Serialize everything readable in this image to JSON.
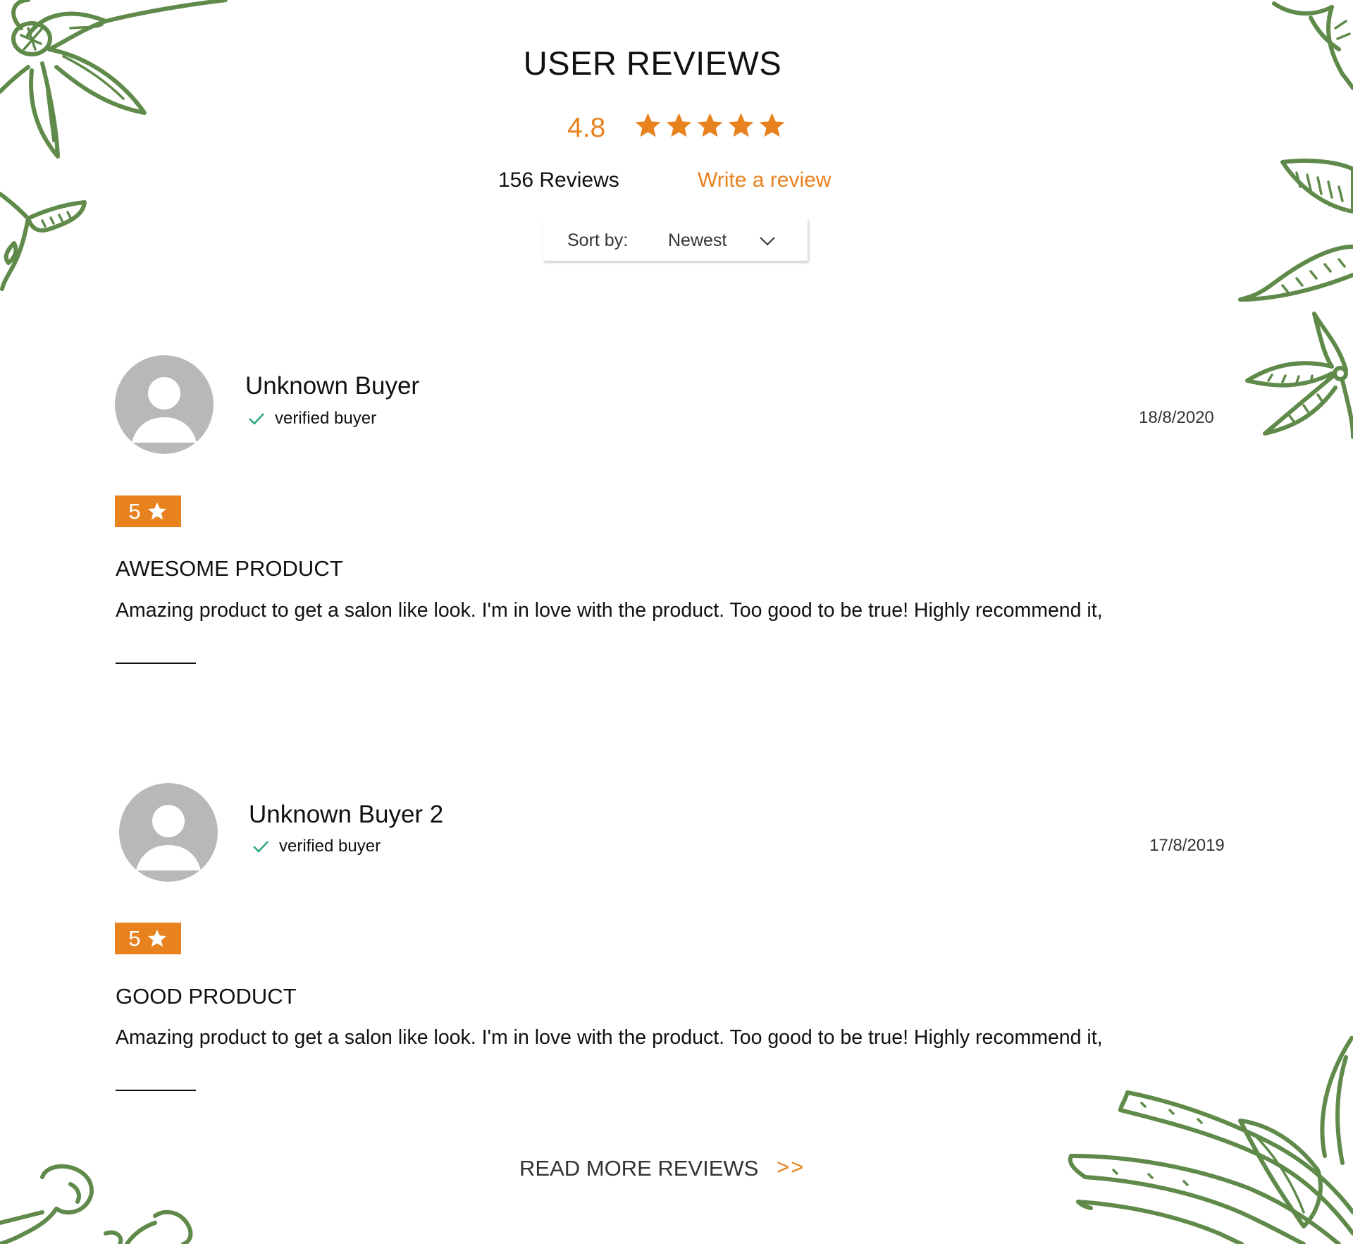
{
  "header": {
    "title": "USER REVIEWS",
    "average_rating": "4.8",
    "average_stars": 5,
    "review_count": "156 Reviews",
    "write_review_label": "Write a review"
  },
  "sort": {
    "label": "Sort by:",
    "selected": "Newest",
    "icon": "chevron-down-icon"
  },
  "reviews": [
    {
      "name": "Unknown Buyer",
      "verified_label": "verified buyer",
      "date": "18/8/2020",
      "rating": "5",
      "title": "AWESOME PRODUCT",
      "body": "Amazing product to get a salon like look. I'm in love with the product. Too good to be true! Highly recommend it,"
    },
    {
      "name": "Unknown Buyer 2",
      "verified_label": "verified buyer",
      "date": "17/8/2019",
      "rating": "5",
      "title": "GOOD PRODUCT",
      "body": "Amazing product to get a salon like look. I'm in love with the product. Too good to be true! Highly recommend it,"
    }
  ],
  "footer": {
    "read_more_label": "READ MORE REVIEWS",
    "read_more_arrow": ">>"
  },
  "colors": {
    "accent": "#e8821e",
    "verified_check": "#2aa876",
    "avatar_gray": "#b8b8b8",
    "botanical_green": "#5f8a4a"
  }
}
